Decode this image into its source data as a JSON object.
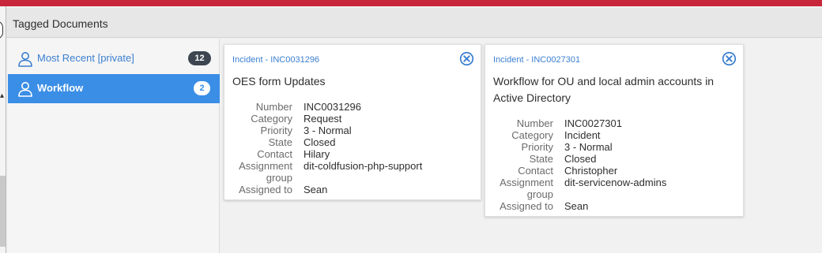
{
  "header": {
    "title": "Tagged Documents"
  },
  "colors": {
    "accent": "#3a8ee6",
    "brand_strip": "#c8263a",
    "link": "#3b7fd0",
    "badge_dark": "#3d4650"
  },
  "sidebar": {
    "items": [
      {
        "label": "Most Recent [private]",
        "count": "12",
        "icon": "user-icon",
        "selected": false
      },
      {
        "label": "Workflow",
        "count": "2",
        "icon": "user-icon",
        "selected": true
      }
    ]
  },
  "cards": [
    {
      "kicker": "Incident - INC0031296",
      "title": "OES form Updates",
      "close_icon": "close-circle-icon",
      "fields": [
        {
          "label": "Number",
          "value": "INC0031296"
        },
        {
          "label": "Category",
          "value": "Request"
        },
        {
          "label": "Priority",
          "value": "3 - Normal"
        },
        {
          "label": "State",
          "value": "Closed"
        },
        {
          "label": "Contact",
          "value": "Hilary"
        },
        {
          "label": "Assignment",
          "value": "dit-coldfusion-php-support"
        },
        {
          "label": "group",
          "value": ""
        },
        {
          "label": "Assigned to",
          "value": "Sean"
        }
      ]
    },
    {
      "kicker": "Incident - INC0027301",
      "title": "Workflow for OU and local admin accounts in Active Directory",
      "close_icon": "close-circle-icon",
      "fields": [
        {
          "label": "Number",
          "value": "INC0027301"
        },
        {
          "label": "Category",
          "value": "Incident"
        },
        {
          "label": "Priority",
          "value": "3 - Normal"
        },
        {
          "label": "State",
          "value": "Closed"
        },
        {
          "label": "Contact",
          "value": "Christopher"
        },
        {
          "label": "Assignment",
          "value": "dit-servicenow-admins"
        },
        {
          "label": "group",
          "value": ""
        },
        {
          "label": "Assigned to",
          "value": "Sean"
        }
      ]
    }
  ]
}
